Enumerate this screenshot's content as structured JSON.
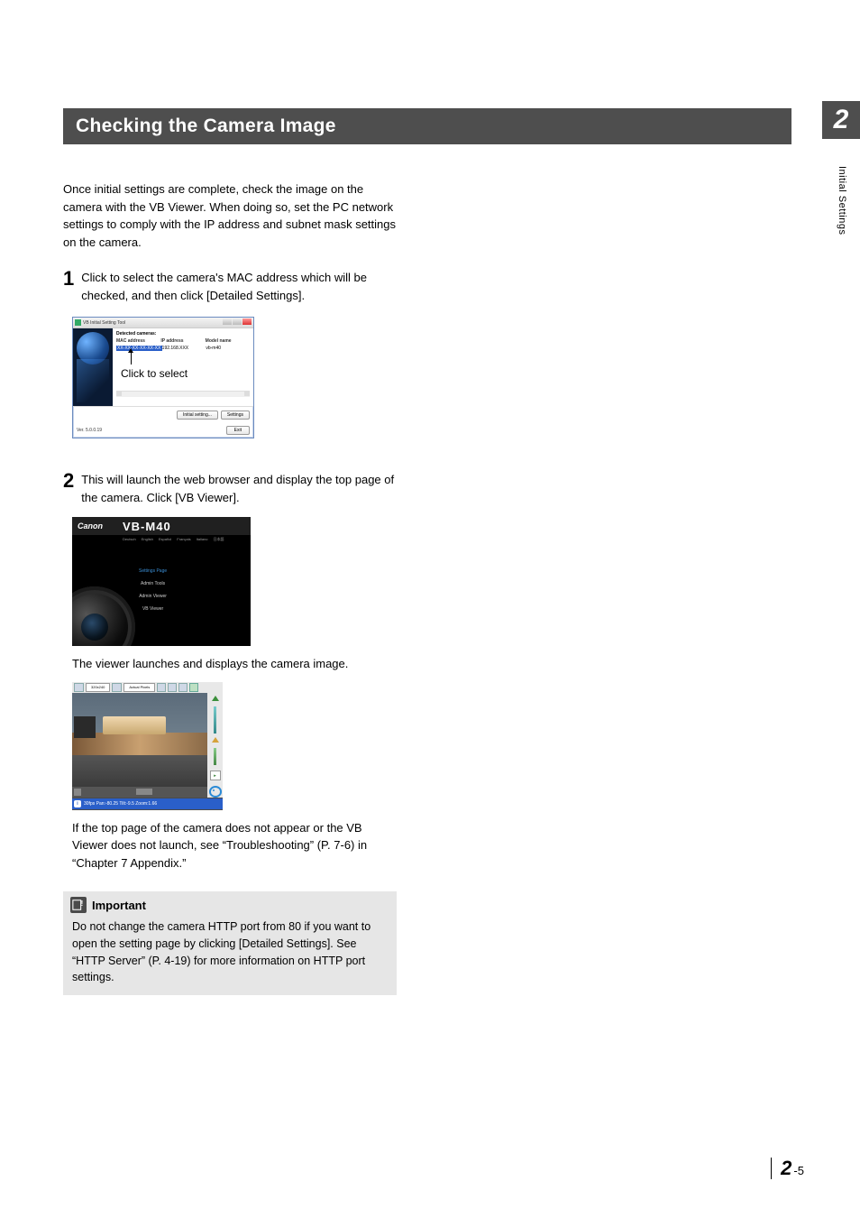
{
  "chapterTab": "2",
  "sideLabel": "Initial Settings",
  "pageNumber": {
    "chapter": "2",
    "sep": "-",
    "page": "5"
  },
  "heading": "Checking the Camera Image",
  "intro": "Once initial settings are complete, check the image on the camera with the VB Viewer. When doing so, set the PC network settings to comply with the IP address and subnet mask settings on the camera.",
  "steps": {
    "s1": {
      "num": "1",
      "text": "Click to select the camera's MAC address which will be checked, and then click [Detailed Settings]."
    },
    "s2": {
      "num": "2",
      "text": "This will launch the web browser and display the top page of the camera. Click [VB Viewer]."
    }
  },
  "fig1": {
    "title": "VB Initial Setting Tool",
    "listHeader": "Detected cameras:",
    "colMac": "MAC address",
    "colIp": "IP address",
    "colModel": "Model name",
    "rowMac": "XX-XX-XX-XX-XX-XX",
    "rowIp": "192.168.XXX",
    "rowModel": "vb-m40",
    "clickLabel": "Click to select",
    "btnInitial": "Initial setting...",
    "btnSettings": "Settings",
    "btnExit": "Exit",
    "version": "Ver. 5.0.0.19"
  },
  "fig2": {
    "logo": "Canon",
    "model": "VB-M40",
    "langs": [
      "Deutsch",
      "English",
      "Español",
      "Français",
      "Italiano",
      "日本語"
    ],
    "links": {
      "settings": "Settings Page",
      "admin": "Admin Tools",
      "adminViewer": "Admin Viewer",
      "vbViewer": "VB Viewer"
    }
  },
  "afterFig2": "The viewer launches and displays the camera image.",
  "fig3": {
    "size": "320x240",
    "pixels": "Actual Pixels",
    "status": "30fps  Pan:-80.25 Tilt:-9.5 Zoom:1.66"
  },
  "afterFig3": "If the top page of the camera does not appear or the VB Viewer does not launch, see “Troubleshooting” (P. 7-6) in “Chapter 7 Appendix.”",
  "important": {
    "label": "Important",
    "body": "Do not change the camera HTTP port from 80 if you want to open the setting page by clicking [Detailed Settings]. See “HTTP Server” (P. 4-19) for more information on HTTP port settings."
  }
}
